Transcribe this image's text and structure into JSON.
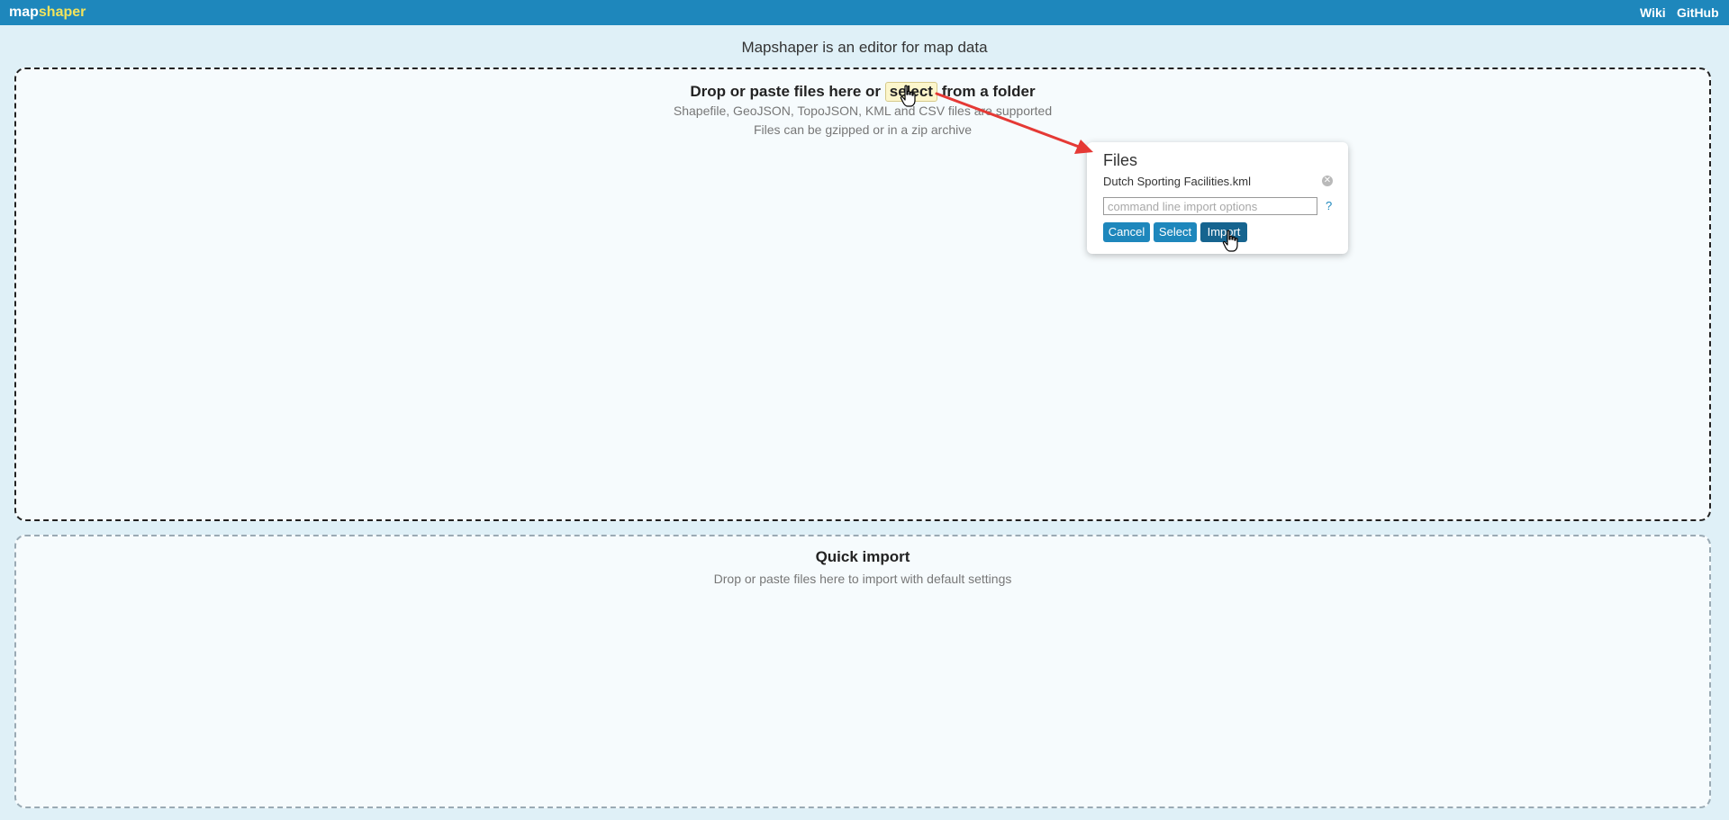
{
  "header": {
    "logo_part1": "map",
    "logo_part2": "shaper",
    "links": [
      "Wiki",
      "GitHub"
    ]
  },
  "headline": "Mapshaper is an editor for map data",
  "dropzone": {
    "text_before": "Drop or paste files here or",
    "select_label": "select",
    "text_after": "from a folder",
    "supported": "Shapefile, GeoJSON, TopoJSON, KML and CSV files are supported",
    "archive": "Files can be gzipped or in a zip archive"
  },
  "files_popup": {
    "title": "Files",
    "file_name": "Dutch Sporting Facilities.kml",
    "options_placeholder": "command line import options",
    "help": "?",
    "buttons": {
      "cancel": "Cancel",
      "select": "Select",
      "import": "Import"
    }
  },
  "quick_import": {
    "title": "Quick import",
    "subtitle": "Drop or paste files here to import with default settings"
  },
  "colors": {
    "topbar": "#1e87bc",
    "logo_accent": "#f2e35c",
    "annotation_arrow": "#e53935",
    "import_button": "#16648f"
  },
  "icons": {
    "remove": "close-circle-icon",
    "cursor": "hand-pointer-icon",
    "annotation": "arrow-annotation"
  }
}
